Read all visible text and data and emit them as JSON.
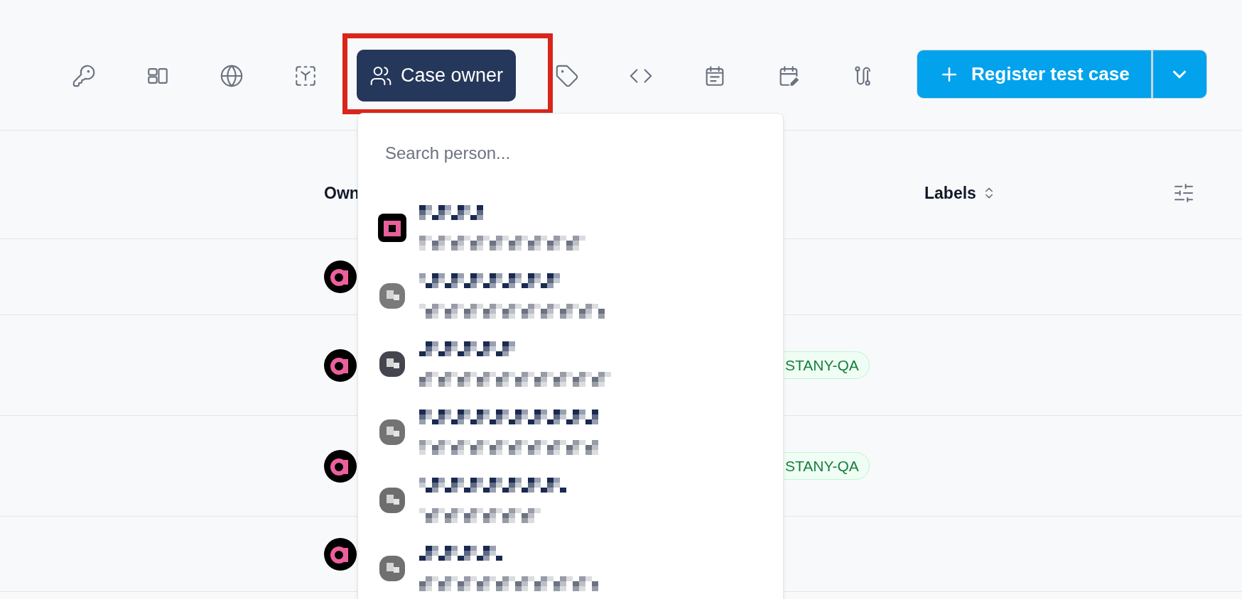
{
  "toolbar": {
    "tools": [
      {
        "selected": false
      },
      {
        "selected": false
      },
      {
        "selected": false
      },
      {
        "selected": false
      },
      {
        "label": "Case owner",
        "selected": true,
        "highlighted": true
      },
      {
        "selected": false
      },
      {
        "selected": false
      },
      {
        "selected": false
      },
      {
        "selected": false
      },
      {
        "selected": false
      }
    ],
    "primary_action": {
      "label": "Register test case"
    }
  },
  "table": {
    "columns": [
      {
        "label": "Own"
      },
      {
        "label": "Labels",
        "sortable": true
      }
    ],
    "rows": [
      {
        "owner": {
          "kind": "logo"
        }
      },
      {
        "owner": {
          "kind": "logo"
        },
        "label": "STANY-QA"
      },
      {
        "owner": {
          "kind": "logo"
        },
        "label": "STANY-QA"
      },
      {
        "owner": {
          "kind": "logo"
        }
      }
    ]
  },
  "person_menu": {
    "search": {
      "placeholder": "Search person..."
    },
    "people": [
      {
        "color": "#e8609a"
      },
      {
        "color": "#7a7a7a"
      },
      {
        "color": "#45454f"
      },
      {
        "color": "#737373"
      },
      {
        "color": "#6e6e6e"
      },
      {
        "color": "#707070"
      }
    ]
  }
}
